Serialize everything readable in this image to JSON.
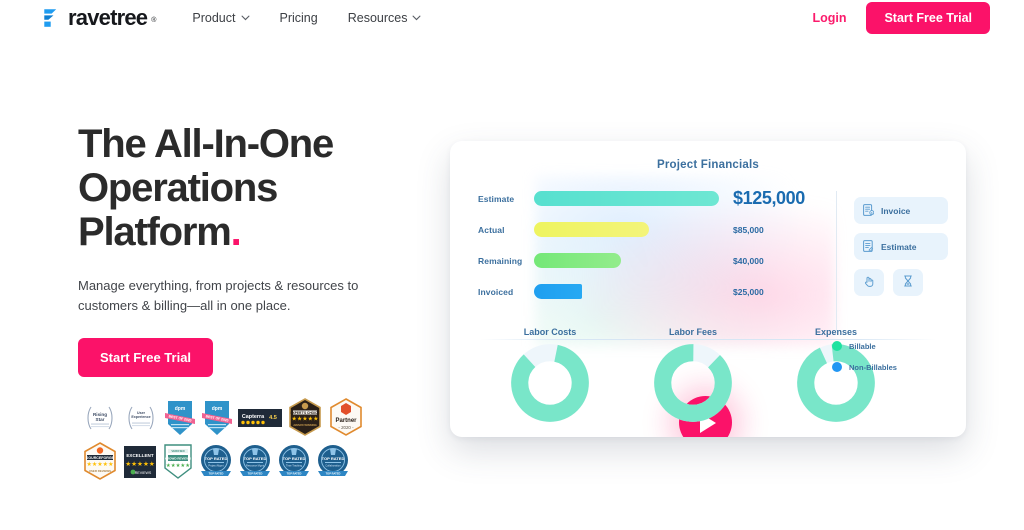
{
  "brand": {
    "name": "ravetree",
    "registered": "®",
    "mark_icon": "ravetree-logo-icon"
  },
  "nav": {
    "links": [
      {
        "label": "Product",
        "has_caret": true,
        "icon": "chevron-down-icon"
      },
      {
        "label": "Pricing",
        "has_caret": false,
        "icon": ""
      },
      {
        "label": "Resources",
        "has_caret": true,
        "icon": "chevron-down-icon"
      }
    ],
    "login_label": "Login",
    "cta_label": "Start Free Trial"
  },
  "hero": {
    "headline_line1": "The All-In-One",
    "headline_line2": "Operations",
    "headline_line3": "Platform",
    "headline_dot": ".",
    "subhead": "Manage everything, from projects & resources to customers & billing—all in one place.",
    "cta_label": "Start Free Trial"
  },
  "colors": {
    "accent_pink": "#fb1269",
    "brand_blue": "#1f9cf0",
    "text_dark": "#2b2b2b",
    "chart_blue_text": "#3b6f9e",
    "estimate_bar": "#5fe3d0",
    "actual_bar": "#f2f364",
    "remaining_bar": "#7de87b",
    "invoiced_bar": "#21a2ee",
    "donut_teal": "#79e6c9",
    "legend_billable": "#1fe3a0",
    "legend_nonbillable": "#2196f3"
  },
  "dashboard": {
    "title": "Project Financials",
    "play_button": "play-icon",
    "tiles": [
      {
        "label": "Invoice",
        "icon": "invoice-document-icon"
      },
      {
        "label": "Estimate",
        "icon": "estimate-document-icon"
      }
    ],
    "small_tiles": [
      {
        "label": "",
        "icon": "hand-click-icon"
      },
      {
        "label": "",
        "icon": "hourglass-timer-icon"
      }
    ],
    "legend": [
      {
        "label": "Billable",
        "color": "#1fe3a0"
      },
      {
        "label": "Non-Billables",
        "color": "#2196f3"
      }
    ]
  },
  "chart_data": [
    {
      "type": "bar",
      "title": "Project Financials",
      "orientation": "horizontal",
      "categories": [
        "Estimate",
        "Actual",
        "Remaining",
        "Invoiced"
      ],
      "values": [
        125000,
        85000,
        40000,
        25000
      ],
      "value_labels": [
        "$125,000",
        "$85,000",
        "$40,000",
        "$25,000"
      ],
      "colors": [
        "#5fe3d0",
        "#f2f364",
        "#7de87b",
        "#21a2ee"
      ],
      "bar_widths_pct": [
        100,
        62,
        47,
        26
      ],
      "xlabel": "",
      "ylabel": "",
      "grid": false,
      "legend": "none"
    },
    {
      "type": "pie",
      "title": "Labor Costs",
      "labels": [
        "Billable",
        "Non-Billables"
      ],
      "values": [
        85,
        15
      ],
      "colors": [
        "#79e6c9",
        "#eef6fb"
      ]
    },
    {
      "type": "pie",
      "title": "Labor Fees",
      "labels": [
        "Billable",
        "Non-Billables"
      ],
      "values": [
        88,
        12
      ],
      "colors": [
        "#79e6c9",
        "#eef6fb"
      ]
    },
    {
      "type": "pie",
      "title": "Expenses",
      "labels": [
        "Billable",
        "Non-Billables"
      ],
      "values": [
        95,
        5
      ],
      "colors": [
        "#79e6c9",
        "#eef6fb"
      ]
    }
  ],
  "badges": {
    "row1": [
      {
        "name": "rising-star-badge",
        "text": "Rising Star"
      },
      {
        "name": "user-experience-badge",
        "text": "User Experience"
      },
      {
        "name": "dpm-best-of-2020-badge",
        "text": "dpm Best Of 2020"
      },
      {
        "name": "dpm-agile-tools-badge",
        "text": "dpm Best Of 2020"
      },
      {
        "name": "capterra-rating-badge",
        "text": "Capterra 4.5"
      },
      {
        "name": "expertise-choice-badge",
        "text": "Expert's Choice"
      },
      {
        "name": "partner-2020-badge",
        "text": "Partner 2020"
      }
    ],
    "row2": [
      {
        "name": "sourceforge-badge",
        "text": "SOURCEFORGE User Reviews"
      },
      {
        "name": "excellent-trustpilot-badge",
        "text": "EXCELLENT"
      },
      {
        "name": "verified-shield-badge",
        "text": "Verified"
      },
      {
        "name": "top-rated-badge-1",
        "text": "TOP RATED"
      },
      {
        "name": "top-rated-badge-2",
        "text": "TOP RATED"
      },
      {
        "name": "top-rated-badge-3",
        "text": "TOP RATED"
      },
      {
        "name": "top-rated-badge-4",
        "text": "TOP RATED"
      }
    ]
  }
}
